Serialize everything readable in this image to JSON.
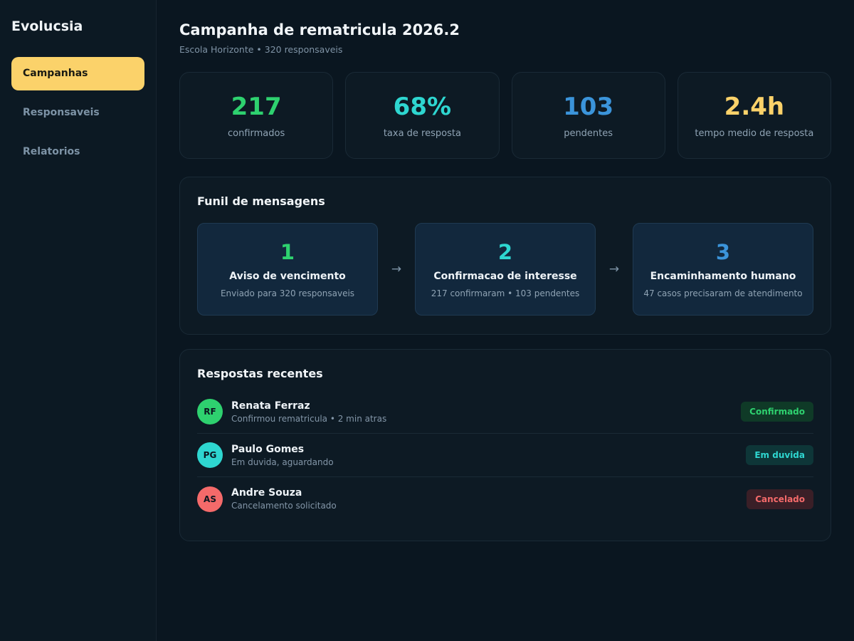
{
  "sidebar": {
    "brand": "Evolucsia",
    "items": [
      {
        "label": "Campanhas",
        "active": true
      },
      {
        "label": "Responsaveis",
        "active": false
      },
      {
        "label": "Relatorios",
        "active": false
      }
    ]
  },
  "header": {
    "title": "Campanha de rematricula 2026.2",
    "subtitle": "Escola Horizonte • 320 responsaveis"
  },
  "stats": [
    {
      "value": "217",
      "label": "confirmados",
      "color": "#2ed16f"
    },
    {
      "value": "68%",
      "label": "taxa de resposta",
      "color": "#2ed6d0"
    },
    {
      "value": "103",
      "label": "pendentes",
      "color": "#3b94da"
    },
    {
      "value": "2.4h",
      "label": "tempo medio de resposta",
      "color": "#fbd26a"
    }
  ],
  "funnel": {
    "title": "Funil de mensagens",
    "arrow": "→",
    "steps": [
      {
        "number": "1",
        "title": "Aviso de vencimento",
        "desc": "Enviado para 320 responsaveis",
        "color": "#2ed16f"
      },
      {
        "number": "2",
        "title": "Confirmacao de interesse",
        "desc": "217 confirmaram • 103 pendentes",
        "color": "#2ed6d0"
      },
      {
        "number": "3",
        "title": "Encaminhamento humano",
        "desc": "47 casos precisaram de atendimento",
        "color": "#3b94da"
      }
    ]
  },
  "responses": {
    "title": "Respostas recentes",
    "rows": [
      {
        "initials": "RF",
        "name": "Renata Ferraz",
        "note": "Confirmou rematricula • 2 min atras",
        "status": "Confirmado",
        "avatar_color": "#2ed16f",
        "badge_bg": "#0f3a27",
        "badge_fg": "#2ed16f"
      },
      {
        "initials": "PG",
        "name": "Paulo Gomes",
        "note": "Em duvida, aguardando",
        "status": "Em duvida",
        "avatar_color": "#2ed6d0",
        "badge_bg": "#0e3638",
        "badge_fg": "#2ed6d0"
      },
      {
        "initials": "AS",
        "name": "Andre Souza",
        "note": "Cancelamento solicitado",
        "status": "Cancelado",
        "avatar_color": "#f46a6a",
        "badge_bg": "#3a1f27",
        "badge_fg": "#f46a6a"
      }
    ]
  }
}
